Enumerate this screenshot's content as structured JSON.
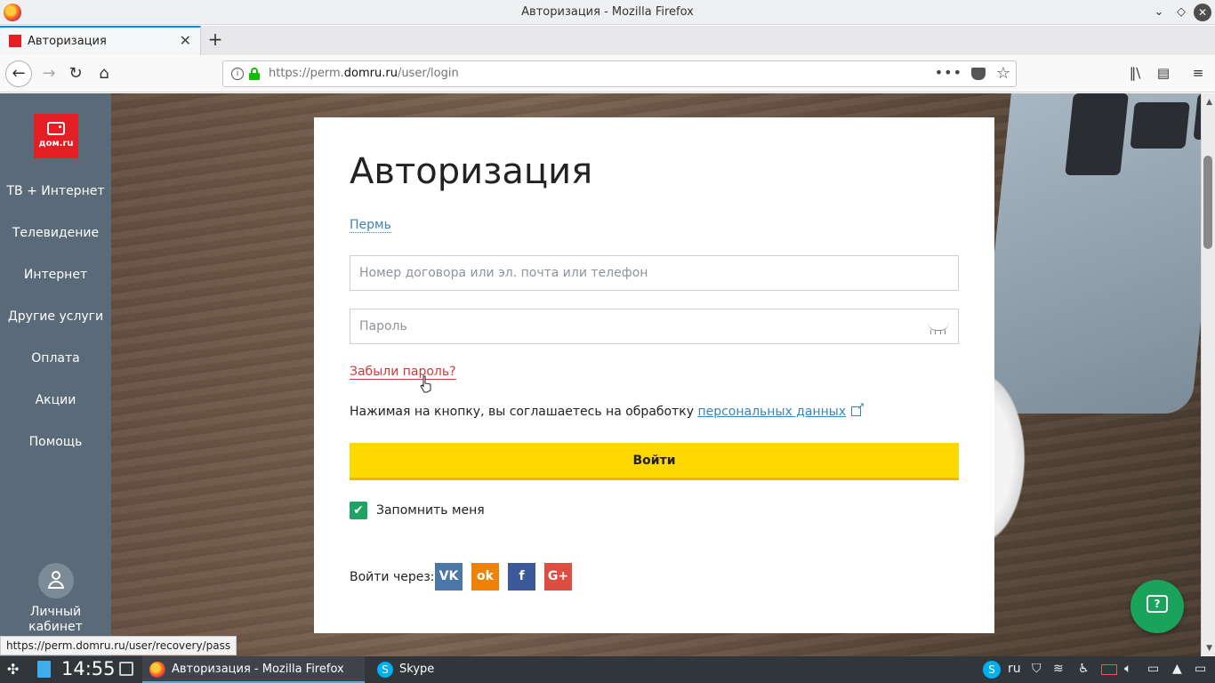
{
  "window": {
    "title": "Авторизация - Mozilla Firefox"
  },
  "tabs": [
    {
      "label": "Авторизация"
    }
  ],
  "urlbar": {
    "url_prefix": "https://perm.",
    "url_domain": "domru.ru",
    "url_path": "/user/login",
    "more": "•••"
  },
  "sidebar": {
    "logo_text": "дом.ru",
    "items": [
      {
        "label": "ТВ + Интернет"
      },
      {
        "label": "Телевидение"
      },
      {
        "label": "Интернет"
      },
      {
        "label": "Другие услуги"
      },
      {
        "label": "Оплата"
      },
      {
        "label": "Акции"
      },
      {
        "label": "Помощь"
      }
    ],
    "account_line1": "Личный",
    "account_line2": "кабинет"
  },
  "login": {
    "title": "Авторизация",
    "city": "Пермь",
    "login_placeholder": "Номер договора или эл. почта или телефон",
    "login_value": "",
    "password_placeholder": "Пароль",
    "password_value": "",
    "forgot_label": "Забыли пароль?",
    "consent_text": "Нажимая на кнопку, вы соглашаетесь на обработку ",
    "consent_link": "персональных данных",
    "submit_label": "Войти",
    "remember_label": "Запомнить меня",
    "remember_checked": true,
    "social_label": "Войти через:",
    "social": [
      {
        "name": "vk",
        "glyph": "VK",
        "color": "#4a76a8"
      },
      {
        "name": "ok",
        "glyph": "ok",
        "color": "#ee8208"
      },
      {
        "name": "facebook",
        "glyph": "f",
        "color": "#3b5998"
      },
      {
        "name": "google-plus",
        "glyph": "G+",
        "color": "#dc4e41"
      }
    ]
  },
  "status_link": "https://perm.domru.ru/user/recovery/pass",
  "taskbar": {
    "clock": "14:55",
    "tasks": [
      {
        "label": "Авторизация - Mozilla Firefox"
      },
      {
        "label": "Skype"
      }
    ],
    "lang": "ru"
  },
  "colors": {
    "accent_yellow": "#ffd800",
    "brand_red": "#e31e24",
    "sidebar": "#5a6a78",
    "chat_green": "#1aa35a",
    "link_blue": "#3a85b8"
  }
}
